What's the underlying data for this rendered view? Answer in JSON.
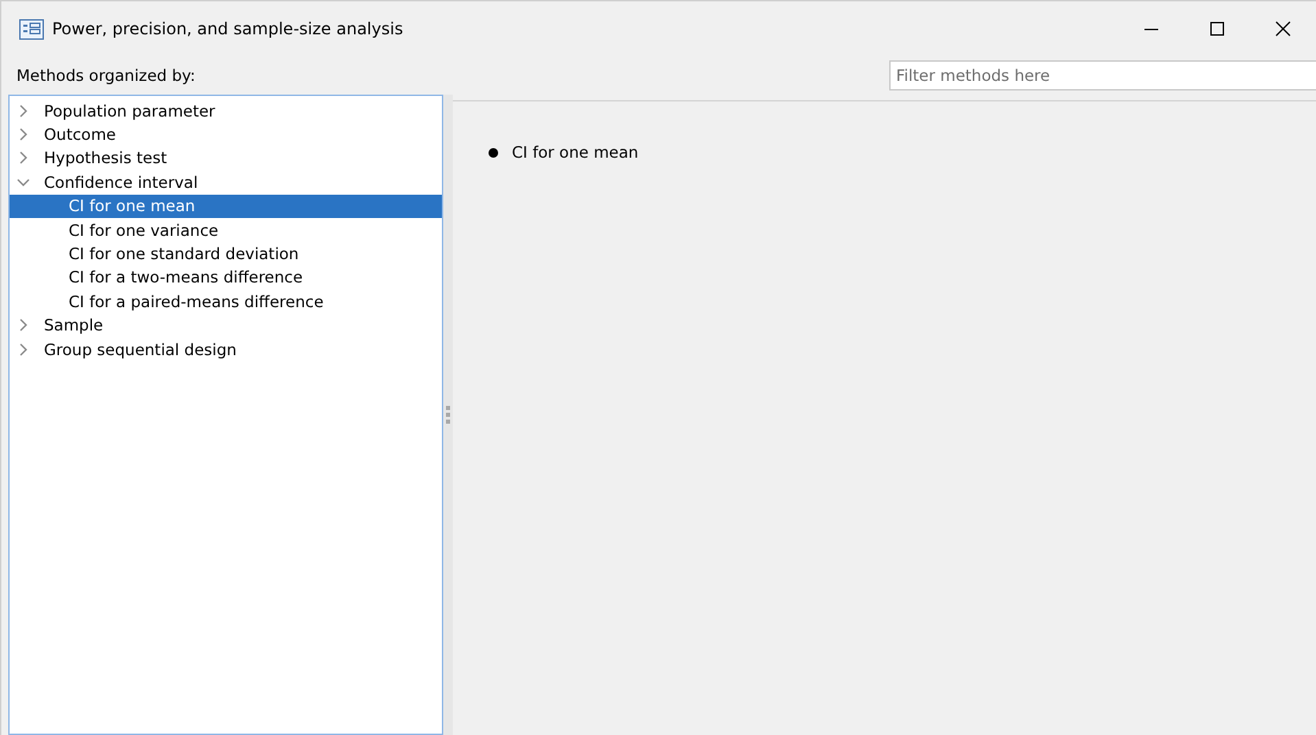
{
  "window": {
    "title": "Power, precision, and sample-size analysis"
  },
  "organized_label": "Methods organized by:",
  "filter": {
    "placeholder": "Filter methods here"
  },
  "tree": [
    {
      "label": "Population parameter",
      "expanded": false,
      "selected": false
    },
    {
      "label": "Outcome",
      "expanded": false,
      "selected": false
    },
    {
      "label": "Hypothesis test",
      "expanded": false,
      "selected": false
    },
    {
      "label": "Confidence interval",
      "expanded": true,
      "selected": false,
      "children": [
        {
          "label": "CI for one mean",
          "selected": true
        },
        {
          "label": "CI for one variance",
          "selected": false
        },
        {
          "label": "CI for one standard deviation",
          "selected": false
        },
        {
          "label": "CI for a two-means difference",
          "selected": false
        },
        {
          "label": "CI for a paired-means difference",
          "selected": false
        }
      ]
    },
    {
      "label": "Sample",
      "expanded": false,
      "selected": false
    },
    {
      "label": "Group sequential design",
      "expanded": false,
      "selected": false
    }
  ],
  "methods": [
    "CI for one mean"
  ]
}
